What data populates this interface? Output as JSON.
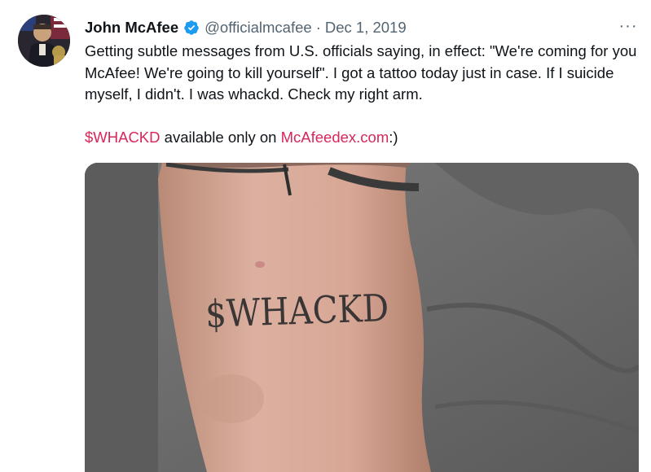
{
  "author": {
    "name": "John McAfee",
    "handle": "@officialmcafee",
    "separator": "·",
    "date": "Dec 1, 2019",
    "verified_icon": "verified-badge-icon"
  },
  "tweet": {
    "text_line1": "Getting subtle messages from U.S. officials saying, in effect: \"We're coming for you McAfee! We're going to kill yourself\". I got a tattoo today just in case. If I suicide myself, I didn't. I was whackd. Check my right arm.",
    "cashtag": "$WHACKD",
    "text_middle": " available only on ",
    "url": "McAfeedex.com",
    "text_end": ":)"
  },
  "media": {
    "tattoo_text": "$WHACKD"
  },
  "more_label": "···",
  "colors": {
    "link": "#d6265a",
    "verified": "#1d9bf0",
    "secondary_text": "#536471"
  }
}
